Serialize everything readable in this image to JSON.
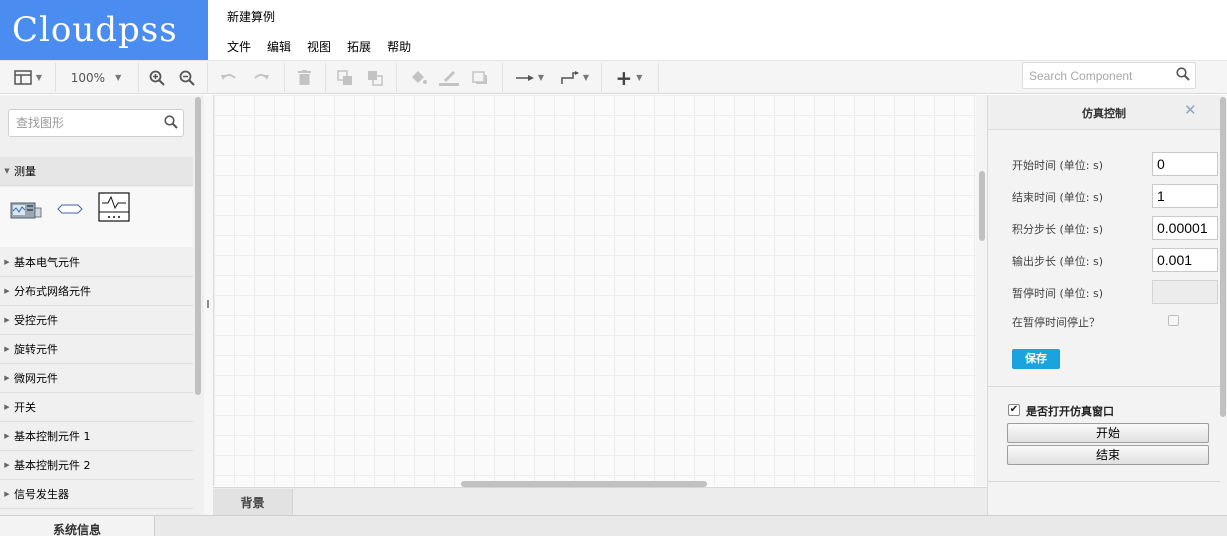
{
  "app": {
    "logo": "Cloudpss",
    "document_title": "新建算例"
  },
  "menu": [
    "文件",
    "编辑",
    "视图",
    "拓展",
    "帮助"
  ],
  "toolbar": {
    "zoom": "100%",
    "search_placeholder": "Search Component",
    "icons": [
      "panel-layout-icon",
      "zoom-in-icon",
      "zoom-out-icon",
      "undo-icon",
      "redo-icon",
      "delete-icon",
      "to-front-icon",
      "to-back-icon",
      "fill-color-icon",
      "line-color-icon",
      "shadow-icon",
      "connector-arrow-icon",
      "waypoint-icon",
      "insert-plus-icon",
      "search-icon"
    ]
  },
  "sidebar": {
    "search_placeholder": "查找图形",
    "open_category": "测量",
    "categories": [
      "基本电气元件",
      "分布式网络元件",
      "受控元件",
      "旋转元件",
      "微网元件",
      "开关",
      "基本控制元件 1",
      "基本控制元件 2",
      "信号发生器"
    ]
  },
  "page_tab": "背景",
  "panel": {
    "title": "仿真控制",
    "fields": [
      {
        "label": "开始时间 (单位: s)",
        "value": "0"
      },
      {
        "label": "结束时间 (单位: s)",
        "value": "1"
      },
      {
        "label": "积分步长 (单位: s)",
        "value": "0.00001"
      },
      {
        "label": "输出步长 (单位: s)",
        "value": "0.001"
      },
      {
        "label": "暂停时间 (单位: s)",
        "value": ""
      }
    ],
    "pause_stop_label": "在暂停时间停止？",
    "save_label": "保存",
    "open_window_label": "是否打开仿真窗口",
    "open_window_checked": true,
    "start_label": "开始",
    "end_label": "结束"
  },
  "bottom": {
    "sysinfo_tab": "系统信息"
  },
  "colors": {
    "brand": "#4a8cf0",
    "save_button": "#1aa3dd"
  }
}
